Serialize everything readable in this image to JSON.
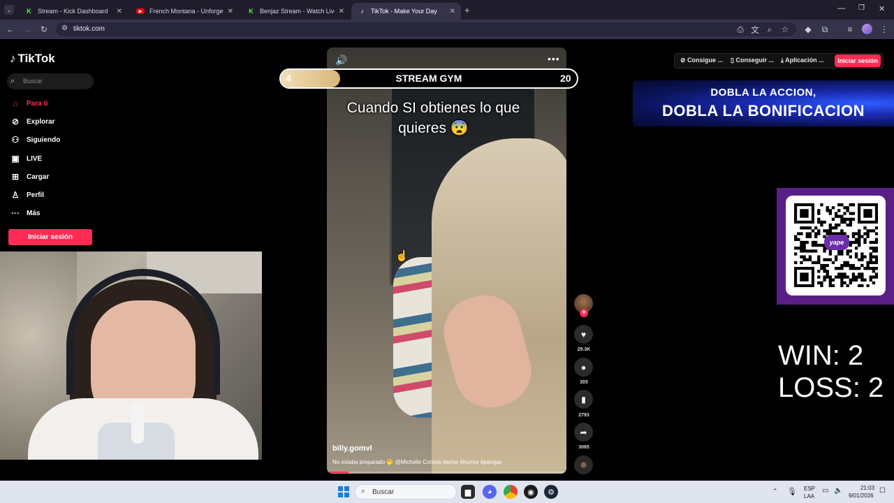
{
  "browser": {
    "tabs": [
      {
        "label": "Stream - Kick Dashboard",
        "favicon": "kick-icon"
      },
      {
        "label": "French Montana - Unforgettabl",
        "favicon": "youtube-icon"
      },
      {
        "label": "Benjaz Stream - Watch Live on",
        "favicon": "kick-icon"
      },
      {
        "label": "TikTok - Make Your Day",
        "favicon": "tiktok-icon",
        "active": true
      }
    ],
    "url": "tiktok.com"
  },
  "tiktok": {
    "logo": "TikTok",
    "search_placeholder": "Buscar",
    "nav": [
      {
        "label": "Para ti",
        "icon": "home-icon",
        "active": true
      },
      {
        "label": "Explorar",
        "icon": "compass-icon"
      },
      {
        "label": "Siguiendo",
        "icon": "following-icon"
      },
      {
        "label": "LIVE",
        "icon": "live-icon"
      },
      {
        "label": "Cargar",
        "icon": "upload-icon"
      },
      {
        "label": "Perfil",
        "icon": "profile-icon"
      },
      {
        "label": "Más",
        "icon": "more-icon"
      }
    ],
    "login_button": "Iniciar sesión",
    "header": {
      "btn1": "Consigue ...",
      "btn2": "Conseguir ...",
      "btn3": "Aplicación ...",
      "login": "Iniciar sesión"
    },
    "video": {
      "caption_overlay": "Cuando SI obtienes lo que quieres 😨",
      "username": "billy.gomvl",
      "description": "No estaba preparado 🤭 @Michelle Corona  #amor #humor #parejas",
      "progress": 0.08
    },
    "actions": {
      "likes": "29.3K",
      "comments": "305",
      "saves": "2793",
      "shares": "3065"
    }
  },
  "overlay": {
    "gym": {
      "left_value": "4",
      "title": "STREAM GYM",
      "right_value": "20",
      "progress": 0.2
    },
    "banner_line1": "DOBLA LA ACCION,",
    "banner_line2": "DOBLA LA BONIFICACION",
    "qr_label": "yape",
    "win": "WIN: 2",
    "loss": "LOSS: 2"
  },
  "taskbar": {
    "search": "Buscar",
    "lang1": "ESP",
    "lang2": "LAA",
    "time": "21:03",
    "date": "9/01/2026"
  },
  "colors": {
    "accent": "#fe2c55",
    "qr_panel": "#5a1f86",
    "banner": "#1a2bb0"
  }
}
